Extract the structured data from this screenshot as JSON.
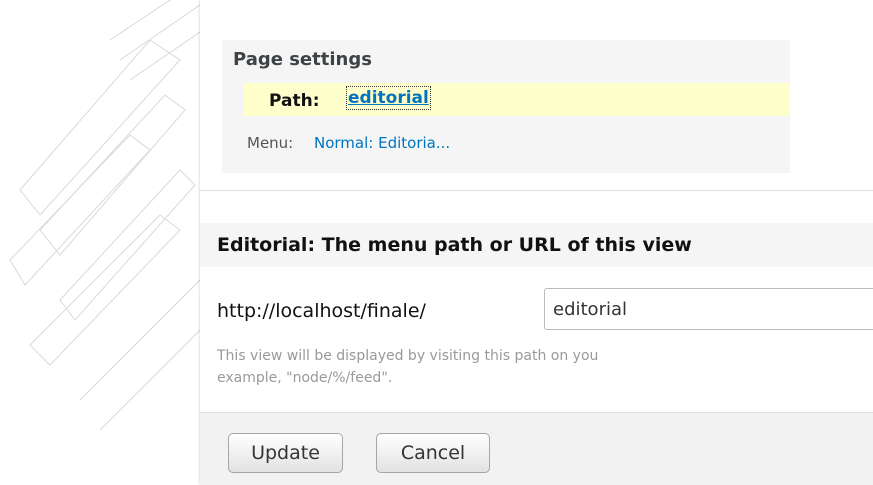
{
  "page_settings": {
    "title": "Page settings",
    "path_label": "Path:",
    "path_value": "editorial",
    "menu_label": "Menu:",
    "menu_value": "Normal: Editoria..."
  },
  "section": {
    "title": "Editorial: The menu path or URL of this view"
  },
  "path_field": {
    "prefix": "http://localhost/finale/",
    "value": "editorial",
    "help_line1": "This view will be displayed by visiting this path on you",
    "help_line2": "example, \"node/%/feed\"."
  },
  "buttons": {
    "update": "Update",
    "cancel": "Cancel"
  }
}
